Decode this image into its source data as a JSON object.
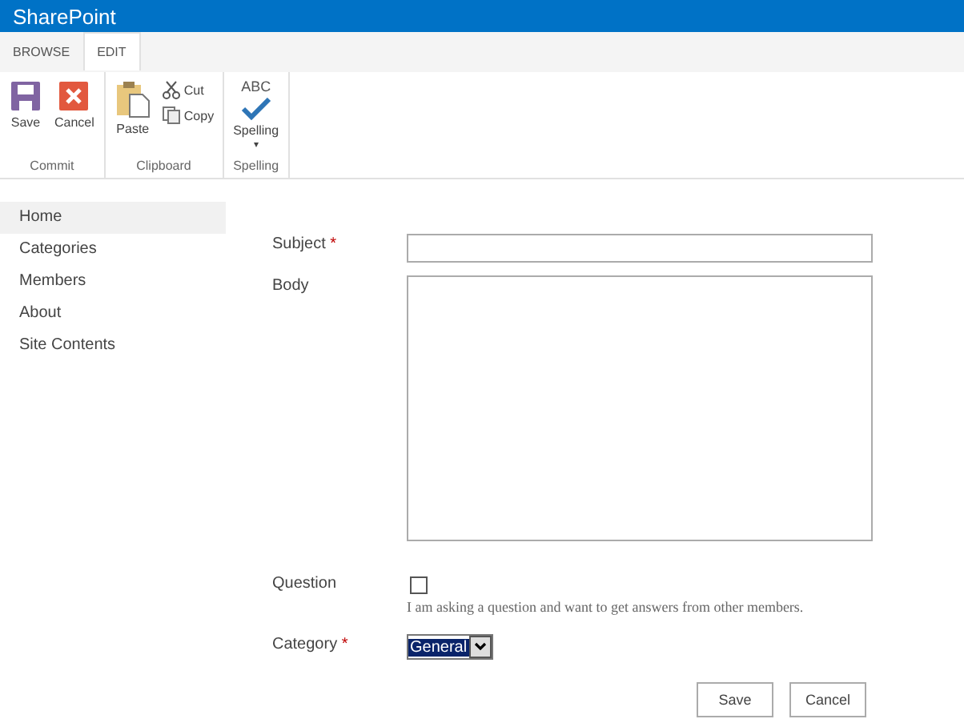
{
  "app_title": "SharePoint",
  "tabs": [
    {
      "label": "BROWSE",
      "selected": false
    },
    {
      "label": "EDIT",
      "selected": true
    }
  ],
  "ribbon_groups": [
    {
      "label": "Commit",
      "commands": [
        {
          "label": "Save",
          "kind": "large"
        },
        {
          "label": "Cancel",
          "kind": "large"
        }
      ]
    },
    {
      "label": "Clipboard",
      "commands": [
        {
          "label": "Paste",
          "kind": "large"
        },
        {
          "label": "Cut",
          "kind": "small"
        },
        {
          "label": "Copy",
          "kind": "small"
        }
      ]
    },
    {
      "label": "Spelling",
      "commands": [
        {
          "label": "Spelling",
          "kind": "large",
          "icon_text": "ABC",
          "dropdown_mark": "▾"
        }
      ]
    }
  ],
  "nav": [
    {
      "label": "Home",
      "selected": true
    },
    {
      "label": "Categories",
      "selected": false
    },
    {
      "label": "Members",
      "selected": false
    },
    {
      "label": "About",
      "selected": false
    },
    {
      "label": "Site Contents",
      "selected": false
    }
  ],
  "form": [
    {
      "kind": "text",
      "label": "Subject",
      "required_mark": "*"
    },
    {
      "kind": "textarea",
      "label": "Body"
    },
    {
      "kind": "checkbox",
      "label": "Question",
      "checked": false,
      "help": "I am asking a question and want to get answers from other members."
    },
    {
      "kind": "select",
      "label": "Category",
      "required_mark": "*",
      "value": "General"
    }
  ],
  "buttons": [
    "Save",
    "Cancel"
  ]
}
